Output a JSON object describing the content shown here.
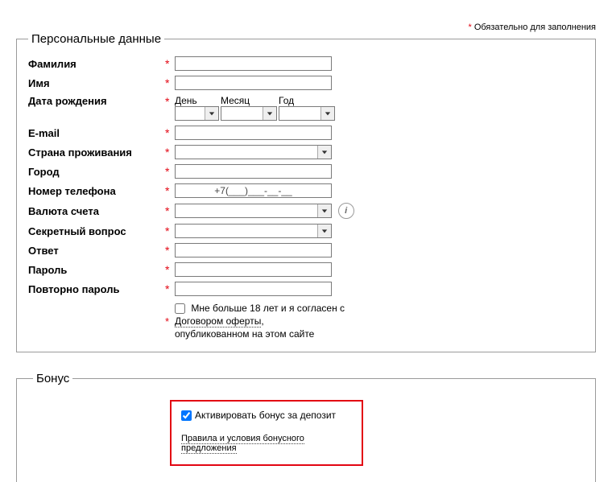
{
  "required_note": {
    "star": "*",
    "text": "Обязательно для заполнения"
  },
  "fieldset_personal": {
    "legend": "Персональные данные"
  },
  "fieldset_bonus": {
    "legend": "Бонус"
  },
  "star": "*",
  "labels": {
    "lastname": "Фамилия",
    "firstname": "Имя",
    "dob": "Дата рождения",
    "email": "E-mail",
    "country": "Страна проживания",
    "city": "Город",
    "phone": "Номер телефона",
    "currency": "Валюта счета",
    "secret_q": "Секретный вопрос",
    "answer": "Ответ",
    "password": "Пароль",
    "password2": "Повторно пароль"
  },
  "dob_headers": {
    "day": "День",
    "month": "Месяц",
    "year": "Год"
  },
  "phone_value": "+7(___)___-__-__",
  "info_icon_glyph": "i",
  "agreement": {
    "line1": "Мне больше 18 лет и я согласен с",
    "link": "Договором оферты",
    "after_link": ",",
    "line2": "опубликованном на этом сайте"
  },
  "bonus": {
    "activate_label": "Активировать бонус за депозит",
    "rules_link": "Правила и условия бонусного предложения"
  }
}
